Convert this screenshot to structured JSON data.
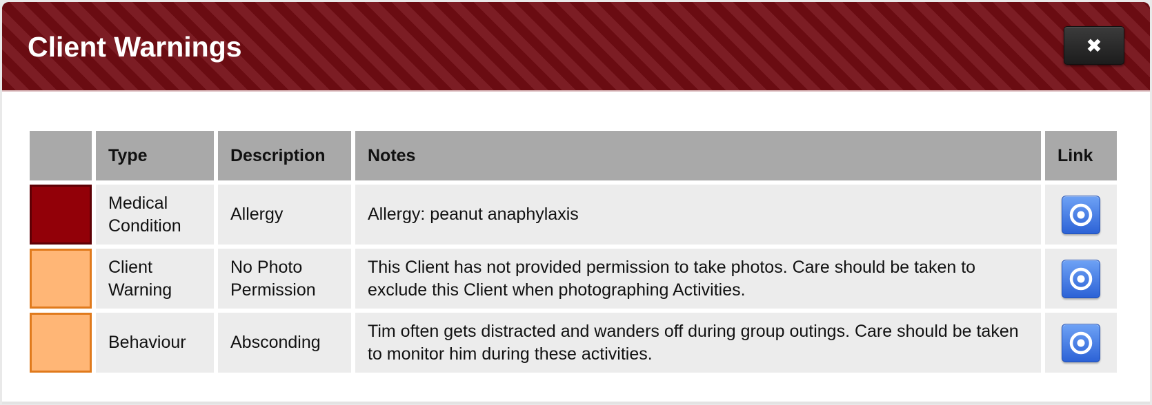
{
  "dialog": {
    "title": "Client Warnings",
    "close_label": "✖"
  },
  "table": {
    "headers": {
      "swatch": "",
      "type": "Type",
      "description": "Description",
      "notes": "Notes",
      "link": "Link"
    },
    "rows": [
      {
        "color": "#920008",
        "border": "#5d0005",
        "type": "Medical Condition",
        "description": "Allergy",
        "notes": "Allergy: peanut anaphylaxis",
        "link_icon": "target-icon"
      },
      {
        "color": "#ffb676",
        "border": "#e07a1c",
        "type": "Client Warning",
        "description": "No Photo Permission",
        "notes": "This Client has not provided permission to take photos. Care should be taken to exclude this Client when photographing Activities.",
        "link_icon": "target-icon"
      },
      {
        "color": "#ffb676",
        "border": "#e07a1c",
        "type": "Behaviour",
        "description": "Absconding",
        "notes": "Tim often gets distracted and wanders off during group outings. Care should be taken to monitor him during these activities.",
        "link_icon": "target-icon"
      }
    ]
  },
  "colors": {
    "header_bg": "#6d0f16",
    "table_header_bg": "#a9a9a9",
    "cell_bg": "#ececec",
    "link_button": "#2c62d6"
  }
}
